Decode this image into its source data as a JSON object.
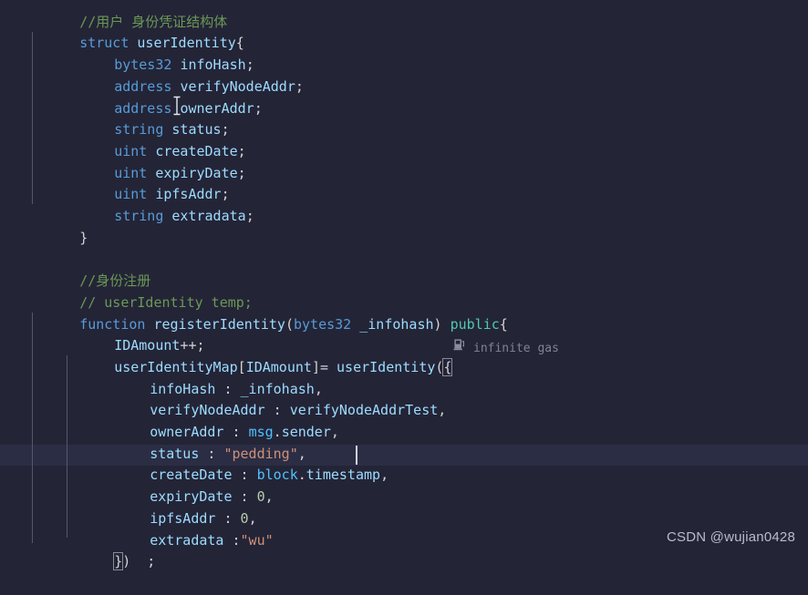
{
  "editor": {
    "language": "solidity",
    "background_color": "#242437",
    "current_line_color": "#2b2d44",
    "font_size_px": 15,
    "line_height_px": 23.7,
    "first_line_clipped": true
  },
  "lines": [
    {
      "n": 1,
      "text": "//用户 身份凭证结构体"
    },
    {
      "n": 2,
      "text": "struct userIdentity{"
    },
    {
      "n": 3,
      "text": "    bytes32 infoHash;"
    },
    {
      "n": 4,
      "text": "    address verifyNodeAddr;"
    },
    {
      "n": 5,
      "text": "    address ownerAddr;"
    },
    {
      "n": 6,
      "text": "    string status;"
    },
    {
      "n": 7,
      "text": "    uint createDate;"
    },
    {
      "n": 8,
      "text": "    uint expiryDate;"
    },
    {
      "n": 9,
      "text": "    uint ipfsAddr;"
    },
    {
      "n": 10,
      "text": "    string extradata;"
    },
    {
      "n": 11,
      "text": "}"
    },
    {
      "n": 12,
      "text": ""
    },
    {
      "n": 13,
      "text": "//身份注册"
    },
    {
      "n": 14,
      "text": "// userIdentity temp;"
    },
    {
      "n": 15,
      "text": "function registerIdentity(bytes32 _infohash) public{"
    },
    {
      "n": 16,
      "text": "    IDAmount++;"
    },
    {
      "n": 17,
      "text": "    userIdentityMap[IDAmount]= userIdentity({"
    },
    {
      "n": 18,
      "text": "        infoHash : _infohash,"
    },
    {
      "n": 19,
      "text": "        verifyNodeAddr : verifyNodeAddrTest,"
    },
    {
      "n": 20,
      "text": "        ownerAddr : msg.sender,"
    },
    {
      "n": 21,
      "text": "        status : \"pedding\","
    },
    {
      "n": 22,
      "text": "        createDate : block.timestamp,"
    },
    {
      "n": 23,
      "text": "        expiryDate : 0,"
    },
    {
      "n": 24,
      "text": "        ipfsAddr : 0,"
    },
    {
      "n": 25,
      "text": "        extradata :\"wu\""
    },
    {
      "n": 26,
      "text": "    })  ;"
    }
  ],
  "tokens": {
    "l1": [
      {
        "t": "//用户 身份凭证结构体",
        "c": "comment"
      }
    ],
    "l2": [
      {
        "t": "struct",
        "c": "kw"
      },
      {
        "t": " ",
        "c": "punc"
      },
      {
        "t": "userIdentity",
        "c": "prop"
      },
      {
        "t": "{",
        "c": "punc"
      }
    ],
    "l3": [
      {
        "t": "bytes32",
        "c": "kw"
      },
      {
        "t": " ",
        "c": "punc"
      },
      {
        "t": "infoHash",
        "c": "prop"
      },
      {
        "t": ";",
        "c": "punc"
      }
    ],
    "l4": [
      {
        "t": "address",
        "c": "kw"
      },
      {
        "t": " ",
        "c": "punc"
      },
      {
        "t": "verifyNodeAddr",
        "c": "prop"
      },
      {
        "t": ";",
        "c": "punc"
      }
    ],
    "l5": [
      {
        "t": "address",
        "c": "kw"
      },
      {
        "t": " ",
        "c": "punc"
      },
      {
        "t": "ownerAddr",
        "c": "prop"
      },
      {
        "t": ";",
        "c": "punc"
      }
    ],
    "l6": [
      {
        "t": "string",
        "c": "kw"
      },
      {
        "t": " ",
        "c": "punc"
      },
      {
        "t": "status",
        "c": "prop"
      },
      {
        "t": ";",
        "c": "punc"
      }
    ],
    "l7": [
      {
        "t": "uint",
        "c": "kw"
      },
      {
        "t": " ",
        "c": "punc"
      },
      {
        "t": "createDate",
        "c": "prop"
      },
      {
        "t": ";",
        "c": "punc"
      }
    ],
    "l8": [
      {
        "t": "uint",
        "c": "kw"
      },
      {
        "t": " ",
        "c": "punc"
      },
      {
        "t": "expiryDate",
        "c": "prop"
      },
      {
        "t": ";",
        "c": "punc"
      }
    ],
    "l9": [
      {
        "t": "uint",
        "c": "kw"
      },
      {
        "t": " ",
        "c": "punc"
      },
      {
        "t": "ipfsAddr",
        "c": "prop"
      },
      {
        "t": ";",
        "c": "punc"
      }
    ],
    "l10": [
      {
        "t": "string",
        "c": "kw"
      },
      {
        "t": " ",
        "c": "punc"
      },
      {
        "t": "extradata",
        "c": "prop"
      },
      {
        "t": ";",
        "c": "punc"
      }
    ],
    "l11": [
      {
        "t": "}",
        "c": "punc"
      }
    ],
    "l13": [
      {
        "t": "//身份注册",
        "c": "comment"
      }
    ],
    "l14": [
      {
        "t": "// userIdentity temp;",
        "c": "comment"
      }
    ],
    "l15": [
      {
        "t": "function",
        "c": "kw"
      },
      {
        "t": " ",
        "c": "punc"
      },
      {
        "t": "registerIdentity",
        "c": "prop"
      },
      {
        "t": "(",
        "c": "punc"
      },
      {
        "t": "bytes32",
        "c": "kw"
      },
      {
        "t": " _infohash",
        "c": "prop"
      },
      {
        "t": ") ",
        "c": "punc"
      },
      {
        "t": "public",
        "c": "type"
      },
      {
        "t": "{",
        "c": "punc"
      }
    ],
    "l16": [
      {
        "t": "IDAmount",
        "c": "prop"
      },
      {
        "t": "++;",
        "c": "punc"
      }
    ],
    "l17": [
      {
        "t": "userIdentityMap",
        "c": "prop"
      },
      {
        "t": "[",
        "c": "punc"
      },
      {
        "t": "IDAmount",
        "c": "prop"
      },
      {
        "t": "]= ",
        "c": "punc"
      },
      {
        "t": "userIdentity",
        "c": "prop"
      },
      {
        "t": "(",
        "c": "punc"
      },
      {
        "t": "{",
        "c": "punc"
      }
    ],
    "l18": [
      {
        "t": "infoHash",
        "c": "prop"
      },
      {
        "t": " : ",
        "c": "punc"
      },
      {
        "t": "_infohash",
        "c": "prop"
      },
      {
        "t": ",",
        "c": "punc"
      }
    ],
    "l19": [
      {
        "t": "verifyNodeAddr",
        "c": "prop"
      },
      {
        "t": " : ",
        "c": "punc"
      },
      {
        "t": "verifyNodeAddrTest",
        "c": "prop"
      },
      {
        "t": ",",
        "c": "punc"
      }
    ],
    "l20": [
      {
        "t": "ownerAddr",
        "c": "prop"
      },
      {
        "t": " : ",
        "c": "punc"
      },
      {
        "t": "msg",
        "c": "glob"
      },
      {
        "t": ".",
        "c": "punc"
      },
      {
        "t": "sender",
        "c": "prop"
      },
      {
        "t": ",",
        "c": "punc"
      }
    ],
    "l21": [
      {
        "t": "status",
        "c": "prop"
      },
      {
        "t": " : ",
        "c": "punc"
      },
      {
        "t": "\"pedding\"",
        "c": "str"
      },
      {
        "t": ",",
        "c": "punc"
      }
    ],
    "l22": [
      {
        "t": "createDate",
        "c": "prop"
      },
      {
        "t": " : ",
        "c": "punc"
      },
      {
        "t": "block",
        "c": "glob"
      },
      {
        "t": ".",
        "c": "punc"
      },
      {
        "t": "timestamp",
        "c": "prop"
      },
      {
        "t": ",",
        "c": "punc"
      }
    ],
    "l23": [
      {
        "t": "expiryDate",
        "c": "prop"
      },
      {
        "t": " : ",
        "c": "punc"
      },
      {
        "t": "0",
        "c": "num"
      },
      {
        "t": ",",
        "c": "punc"
      }
    ],
    "l24": [
      {
        "t": "ipfsAddr",
        "c": "prop"
      },
      {
        "t": " : ",
        "c": "punc"
      },
      {
        "t": "0",
        "c": "num"
      },
      {
        "t": ",",
        "c": "punc"
      }
    ],
    "l25": [
      {
        "t": "extradata",
        "c": "prop"
      },
      {
        "t": " :",
        "c": "punc"
      },
      {
        "t": "\"wu\"",
        "c": "str"
      }
    ],
    "l26": [
      {
        "t": "}",
        "c": "punc",
        "box": true
      },
      {
        "t": ")  ;",
        "c": "punc"
      }
    ]
  },
  "inline_hints": [
    {
      "id": "gas",
      "icon": "gas-pump-icon",
      "label": "infinite gas",
      "line": 17
    }
  ],
  "caret": {
    "line": 22,
    "after_text": "createDate : block.timestamp,"
  },
  "mouse_pointer": {
    "type": "i-beam-cursor",
    "line": 6
  },
  "watermark": {
    "text": "CSDN @wujian0428"
  }
}
